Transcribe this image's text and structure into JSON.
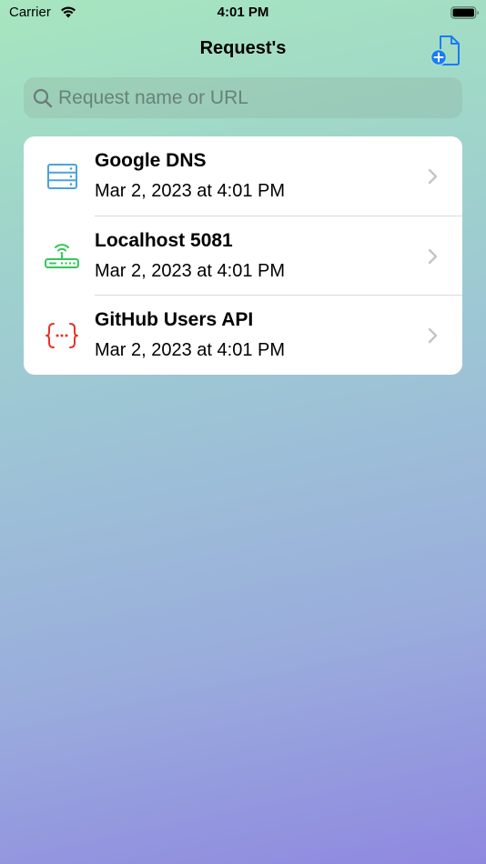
{
  "status_bar": {
    "carrier": "Carrier",
    "time": "4:01 PM"
  },
  "nav": {
    "title": "Request's",
    "add_icon": "doc-plus-icon"
  },
  "search": {
    "placeholder": "Request name or URL",
    "value": ""
  },
  "requests": [
    {
      "title": "Google DNS",
      "date": "Mar 2, 2023 at 4:01 PM",
      "icon": "server-rack-icon",
      "icon_color": "#4aa3df"
    },
    {
      "title": "Localhost 5081",
      "date": "Mar 2, 2023 at 4:01 PM",
      "icon": "wifi-router-icon",
      "icon_color": "#34c759"
    },
    {
      "title": "GitHub Users API",
      "date": "Mar 2, 2023 at 4:01 PM",
      "icon": "curly-braces-icon",
      "icon_color": "#e5332a"
    }
  ],
  "colors": {
    "accent": "#1a7cf5",
    "chevron": "#c4c4c7"
  }
}
